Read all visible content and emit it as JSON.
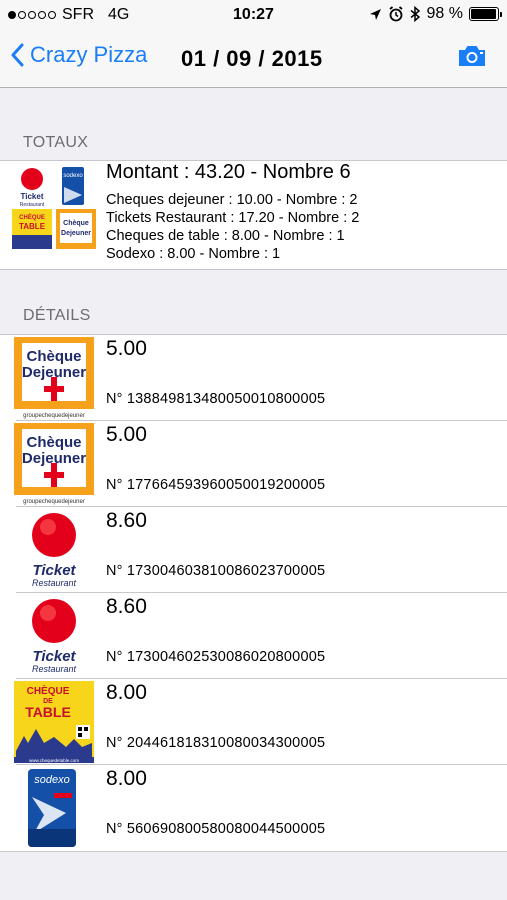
{
  "status_bar": {
    "carrier": "SFR",
    "network": "4G",
    "time": "10:27",
    "battery": "98 %",
    "signal_bars_filled": 1,
    "signal_bars_total": 5,
    "battery_level": 0.98
  },
  "nav": {
    "back_label": "Crazy Pizza",
    "title": "01 / 09 / 2015",
    "accent_color": "#1a7ef7"
  },
  "totaux": {
    "header": "TOTAUX",
    "title": "Montant : 43.20 - Nombre 6",
    "lines": [
      "Cheques dejeuner : 10.00 - Nombre : 2",
      "Tickets Restaurant : 17.20 - Nombre : 2",
      "Cheques de table : 8.00 - Nombre : 1",
      "Sodexo : 8.00 - Nombre : 1"
    ]
  },
  "details": {
    "header": "DÉTAILS",
    "items": [
      {
        "type": "cheque-dejeuner",
        "amount": "5.00",
        "number": "N° 13884981348005001080000​5",
        "logo_top": "Chèque",
        "logo_bottom": "Dejeuner",
        "logo_caption": "groupechequedejeuner"
      },
      {
        "type": "cheque-dejeuner",
        "amount": "5.00",
        "number": "N° 17766459396005001920000​5",
        "logo_top": "Chèque",
        "logo_bottom": "Dejeuner",
        "logo_caption": "groupechequedejeuner"
      },
      {
        "type": "ticket-restaurant",
        "amount": "8.60",
        "number": "N° 17300460381008602370000​5",
        "logo_top": "Ticket",
        "logo_bottom": "Restaurant"
      },
      {
        "type": "ticket-restaurant",
        "amount": "8.60",
        "number": "N° 17300460253008602080000​5",
        "logo_top": "Ticket",
        "logo_bottom": "Restaurant"
      },
      {
        "type": "cheque-de-table",
        "amount": "8.00",
        "number": "N° 20446181831008003430000​5",
        "logo_top": "CHÈQUE",
        "logo_mid": "DE",
        "logo_bottom": "TABLE",
        "logo_caption": "www.chequedetable.com"
      },
      {
        "type": "sodexo",
        "amount": "8.00",
        "number": "N° 56069080058008004450000​5",
        "logo_top": "sodexo"
      }
    ]
  }
}
